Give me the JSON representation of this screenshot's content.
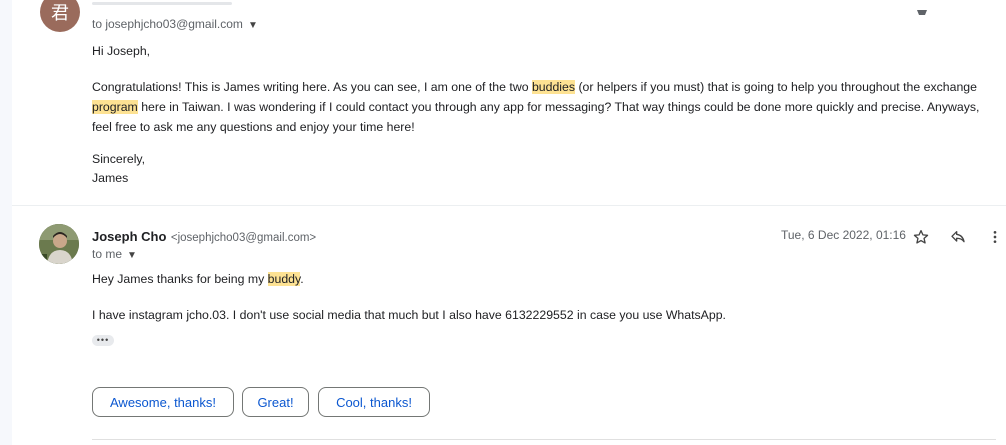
{
  "colors": {
    "link": "#0b57d0",
    "highlight": "#fde293",
    "avatar_top": "#9a6b5c"
  },
  "prev_message": {
    "avatar_letter": "君",
    "to_line": "to josephjcho03@gmail.com",
    "greeting": "Hi Joseph,",
    "para_1_a": "Congratulations! This is James writing here. As you can see, I am one of the two ",
    "para_1_hl1": "buddies",
    "para_1_b": " (or helpers if you must) that is going to help you throughout the exchange",
    "para_1_hl2": "program",
    "para_1_c": " here in Taiwan. I was wondering if I could contact you through any app for messaging? That way things could be done more quickly and precise. Anyways, feel free to ask me any questions and enjoy your time here!",
    "signoff": "Sincerely,",
    "signature": "James"
  },
  "message": {
    "sender_name": "Joseph Cho",
    "sender_email": "<josephjcho03@gmail.com>",
    "to_line": "to me",
    "date": "Tue, 6 Dec 2022, 01:16",
    "line_1_a": "Hey James thanks for being my ",
    "line_1_hl": "buddy",
    "line_1_b": ".",
    "line_2": "I have instagram jcho.03. I don't use social media that much but I also have 6132229552 in case you use WhatsApp.",
    "trimmed": "•••",
    "icons": [
      "star-icon",
      "reply-icon",
      "more-vert-icon"
    ]
  },
  "smart_replies": [
    "Awesome, thanks!",
    "Great!",
    "Cool, thanks!"
  ]
}
